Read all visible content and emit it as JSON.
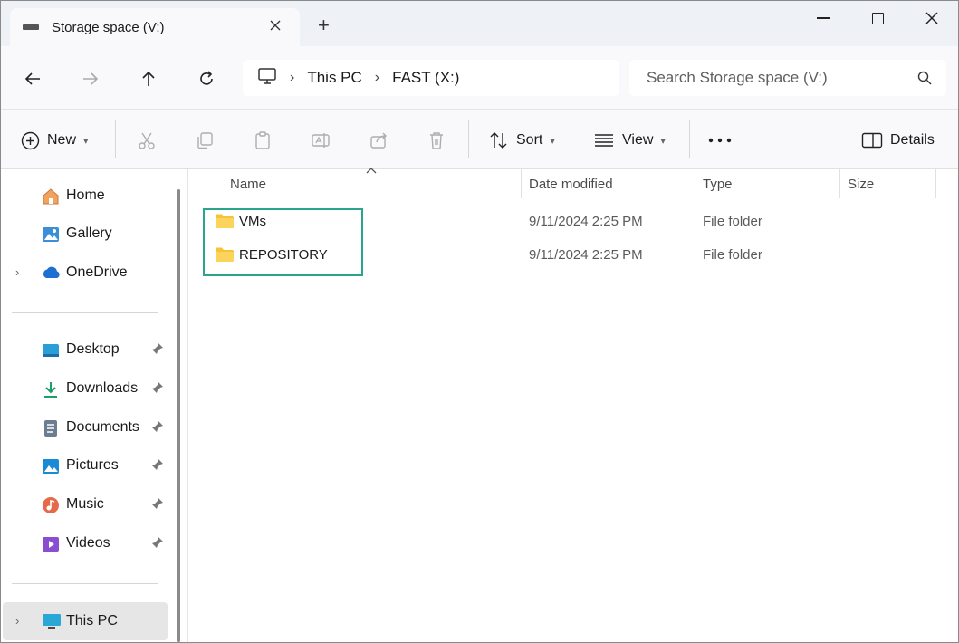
{
  "window": {
    "tab_title": "Storage space (V:)",
    "new_tab": "+"
  },
  "address": {
    "crumbs": [
      "This PC",
      "FAST (X:)"
    ],
    "search_placeholder": "Search Storage space (V:)"
  },
  "toolbar": {
    "new_label": "New",
    "sort_label": "Sort",
    "view_label": "View",
    "details_label": "Details"
  },
  "sidebar": {
    "top_items": [
      {
        "label": "Home",
        "icon": "home-icon"
      },
      {
        "label": "Gallery",
        "icon": "gallery-icon"
      },
      {
        "label": "OneDrive",
        "icon": "cloud-icon"
      }
    ],
    "quick_access": [
      {
        "label": "Desktop",
        "icon": "desktop-icon"
      },
      {
        "label": "Downloads",
        "icon": "download-icon"
      },
      {
        "label": "Documents",
        "icon": "documents-icon"
      },
      {
        "label": "Pictures",
        "icon": "pictures-icon"
      },
      {
        "label": "Music",
        "icon": "music-icon"
      },
      {
        "label": "Videos",
        "icon": "videos-icon"
      }
    ],
    "bottom_items": [
      {
        "label": "This PC",
        "icon": "computer-icon"
      }
    ]
  },
  "columns": {
    "name": "Name",
    "date": "Date modified",
    "type": "Type",
    "size": "Size"
  },
  "files": [
    {
      "name": "VMs",
      "date": "9/11/2024 2:25 PM",
      "type": "File folder"
    },
    {
      "name": "REPOSITORY",
      "date": "9/11/2024 2:25 PM",
      "type": "File folder"
    }
  ],
  "colors": {
    "accent": "#0067c0",
    "highlight_box": "#2aa58c",
    "folder": "#f8c33a"
  }
}
